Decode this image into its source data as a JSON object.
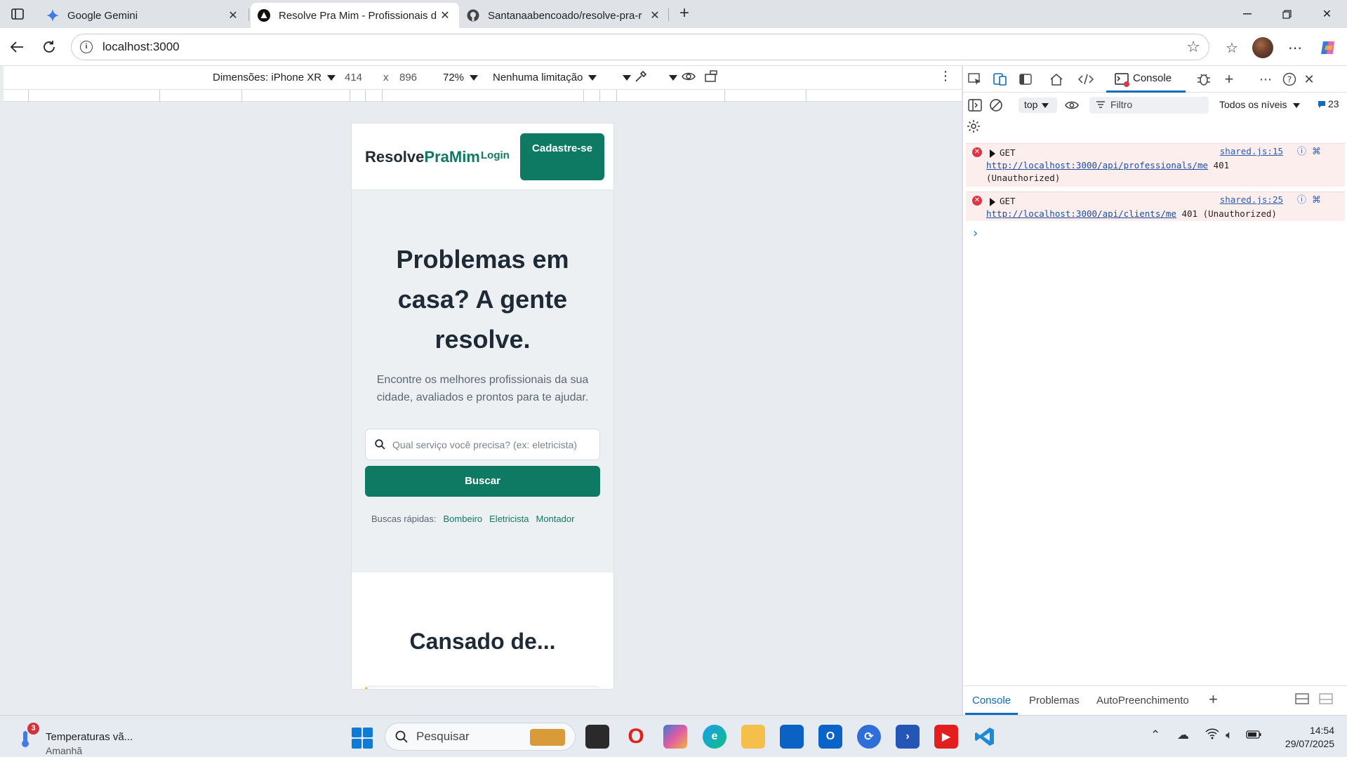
{
  "browser": {
    "tabs": [
      {
        "title": "Google Gemini",
        "icon": "gemini-icon"
      },
      {
        "title": "Resolve Pra Mim - Profissionais d",
        "icon": "site-icon",
        "active": true
      },
      {
        "title": "Santanaabencoado/resolve-pra-r",
        "icon": "github-icon"
      }
    ],
    "address": "localhost:3000"
  },
  "emulation": {
    "device": "Dimensões: iPhone XR",
    "width": "414",
    "times": "x",
    "height": "896",
    "zoom": "72%",
    "throttle": "Nenhuma limitação"
  },
  "site": {
    "logo_part1": "Resolve",
    "logo_part2": "PraMim",
    "login": "Login",
    "signup": "Cadastre-se",
    "hero_title": "Problemas em casa? A gente resolve.",
    "hero_subtitle": "Encontre os melhores profissionais da sua cidade, avaliados e prontos para te ajudar.",
    "search_placeholder": "Qual serviço você precisa? (ex: eletricista)",
    "search_button": "Buscar",
    "quick_label": "Buscas rápidas:",
    "quick_links": [
      "Bombeiro",
      "Eletricista",
      "Montador"
    ],
    "section_title": "Cansado de..."
  },
  "devtools": {
    "console_tab": "Console",
    "context": "top",
    "filter_placeholder": "Filtro",
    "levels": "Todos os níveis",
    "issues": "23",
    "logs": [
      {
        "method": "GET",
        "source": "shared.js:15",
        "url": "http://localhost:3000/api/professionals/me",
        "status": "401",
        "status_text": "(Unauthorized)"
      },
      {
        "method": "GET",
        "source": "shared.js:25",
        "url": "http://localhost:3000/api/clients/me",
        "status": "401",
        "status_text": "(Unauthorized)"
      }
    ],
    "drawer_tabs": [
      "Console",
      "Problemas",
      "AutoPreenchimento"
    ]
  },
  "taskbar": {
    "weather_badge": "3",
    "weather_title": "Temperaturas vã...",
    "weather_sub": "Amanhã",
    "search_placeholder": "Pesquisar",
    "time": "14:54",
    "date": "29/07/2025"
  }
}
